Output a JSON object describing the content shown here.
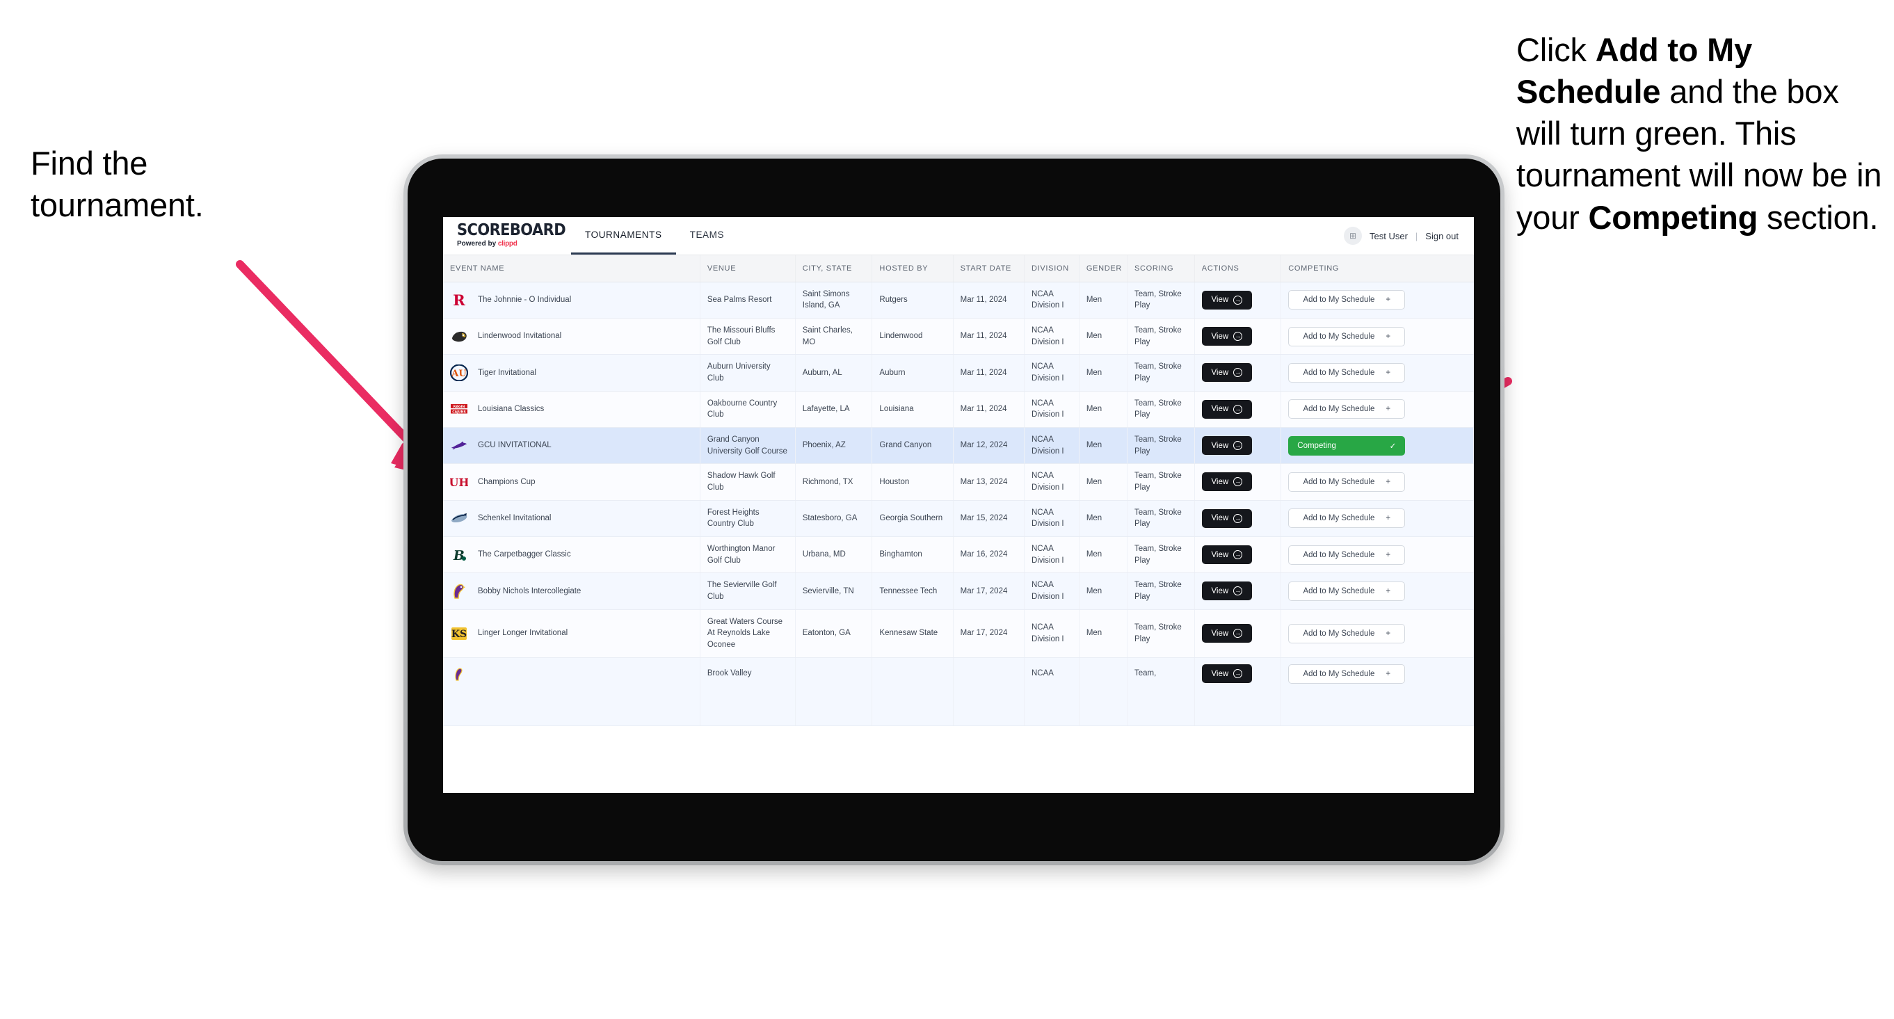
{
  "annotations": {
    "left": {
      "lines": [
        "Find the",
        "tournament."
      ]
    },
    "right": {
      "pre1": "Click ",
      "bold1": "Add to My Schedule",
      "mid": " and the box will turn green. This tournament will now be in your ",
      "bold2": "Competing",
      "post": " section."
    }
  },
  "app": {
    "brand": {
      "title": "SCOREBOARD",
      "powered_by": "Powered by ",
      "vendor": "clippd"
    },
    "nav_tabs": [
      {
        "label": "TOURNAMENTS",
        "active": true
      },
      {
        "label": "TEAMS",
        "active": false
      }
    ],
    "user": {
      "name": "Test User",
      "separator": "|",
      "sign_out": "Sign out",
      "avatar_glyph": "⊞"
    }
  },
  "table": {
    "columns": [
      "EVENT NAME",
      "VENUE",
      "CITY, STATE",
      "HOSTED BY",
      "START DATE",
      "DIVISION",
      "GENDER",
      "SCORING",
      "ACTIONS",
      "COMPETING"
    ],
    "view_label": "View",
    "add_label": "Add to My Schedule",
    "add_glyph": "+",
    "competing_label": "Competing",
    "competing_glyph": "✓",
    "rows": [
      {
        "event": "The Johnnie - O Individual",
        "venue": "Sea Palms Resort",
        "city": "Saint Simons Island, GA",
        "hosted_by": "Rutgers",
        "start_date": "Mar 11, 2024",
        "division": "NCAA Division I",
        "gender": "Men",
        "scoring": "Team, Stroke Play",
        "competing": false,
        "logo": "rutgers-r-logo"
      },
      {
        "event": "Lindenwood Invitational",
        "venue": "The Missouri Bluffs Golf Club",
        "city": "Saint Charles, MO",
        "hosted_by": "Lindenwood",
        "start_date": "Mar 11, 2024",
        "division": "NCAA Division I",
        "gender": "Men",
        "scoring": "Team, Stroke Play",
        "competing": false,
        "logo": "lindenwood-lion-logo"
      },
      {
        "event": "Tiger Invitational",
        "venue": "Auburn University Club",
        "city": "Auburn, AL",
        "hosted_by": "Auburn",
        "start_date": "Mar 11, 2024",
        "division": "NCAA Division I",
        "gender": "Men",
        "scoring": "Team, Stroke Play",
        "competing": false,
        "logo": "auburn-au-logo"
      },
      {
        "event": "Louisiana Classics",
        "venue": "Oakbourne Country Club",
        "city": "Lafayette, LA",
        "hosted_by": "Louisiana",
        "start_date": "Mar 11, 2024",
        "division": "NCAA Division I",
        "gender": "Men",
        "scoring": "Team, Stroke Play",
        "competing": false,
        "logo": "louisiana-ragin-cajuns-logo"
      },
      {
        "event": "GCU INVITATIONAL",
        "venue": "Grand Canyon University Golf Course",
        "city": "Phoenix, AZ",
        "hosted_by": "Grand Canyon",
        "start_date": "Mar 12, 2024",
        "division": "NCAA Division I",
        "gender": "Men",
        "scoring": "Team, Stroke Play",
        "competing": true,
        "logo": "grand-canyon-lope-logo"
      },
      {
        "event": "Champions Cup",
        "venue": "Shadow Hawk Golf Club",
        "city": "Richmond, TX",
        "hosted_by": "Houston",
        "start_date": "Mar 13, 2024",
        "division": "NCAA Division I",
        "gender": "Men",
        "scoring": "Team, Stroke Play",
        "competing": false,
        "logo": "houston-uh-logo"
      },
      {
        "event": "Schenkel Invitational",
        "venue": "Forest Heights Country Club",
        "city": "Statesboro, GA",
        "hosted_by": "Georgia Southern",
        "start_date": "Mar 15, 2024",
        "division": "NCAA Division I",
        "gender": "Men",
        "scoring": "Team, Stroke Play",
        "competing": false,
        "logo": "georgia-southern-eagle-logo"
      },
      {
        "event": "The Carpetbagger Classic",
        "venue": "Worthington Manor Golf Club",
        "city": "Urbana, MD",
        "hosted_by": "Binghamton",
        "start_date": "Mar 16, 2024",
        "division": "NCAA Division I",
        "gender": "Men",
        "scoring": "Team, Stroke Play",
        "competing": false,
        "logo": "binghamton-b-logo"
      },
      {
        "event": "Bobby Nichols Intercollegiate",
        "venue": "The Sevierville Golf Club",
        "city": "Sevierville, TN",
        "hosted_by": "Tennessee Tech",
        "start_date": "Mar 17, 2024",
        "division": "NCAA Division I",
        "gender": "Men",
        "scoring": "Team, Stroke Play",
        "competing": false,
        "logo": "tennessee-tech-eagle-logo"
      },
      {
        "event": "Linger Longer Invitational",
        "venue": "Great Waters Course At Reynolds Lake Oconee",
        "city": "Eatonton, GA",
        "hosted_by": "Kennesaw State",
        "start_date": "Mar 17, 2024",
        "division": "NCAA Division I",
        "gender": "Men",
        "scoring": "Team, Stroke Play",
        "competing": false,
        "logo": "kennesaw-state-ksu-logo"
      },
      {
        "event": "",
        "venue": "Brook Valley",
        "city": "",
        "hosted_by": "",
        "start_date": "",
        "division": "NCAA",
        "gender": "",
        "scoring": "Team,",
        "competing": false,
        "logo": "clipped-row-logo"
      }
    ]
  },
  "colors": {
    "accent_arrow": "#ea2c62",
    "competing_green": "#28a745",
    "brand_red": "#f0344e",
    "selected_row": "#dbe7fb",
    "dark_button": "#15171c"
  }
}
